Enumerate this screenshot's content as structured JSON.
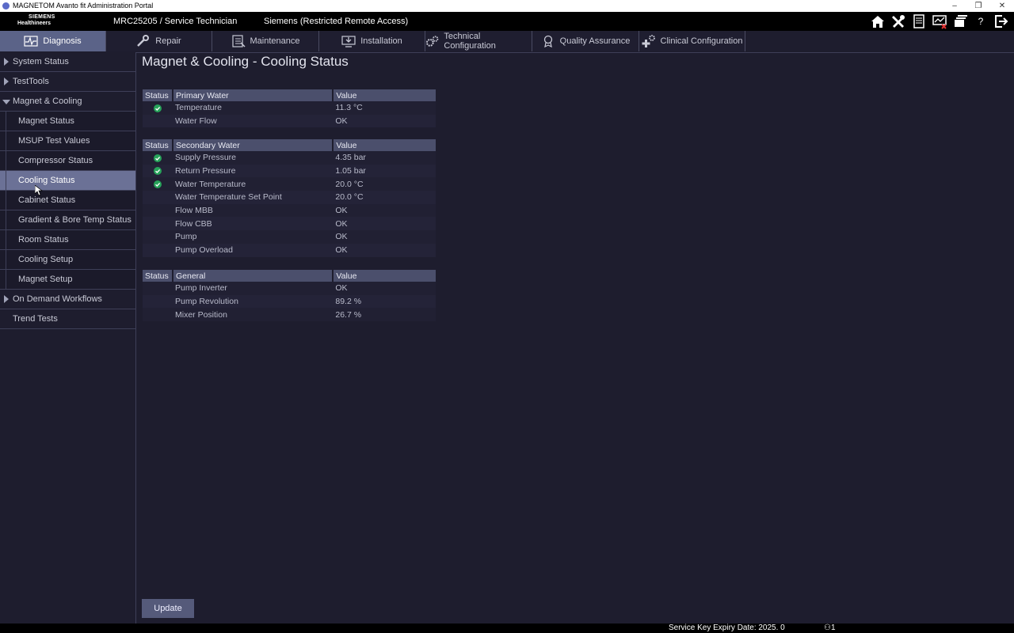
{
  "window": {
    "title": "MAGNETOM Avanto fit Administration Portal",
    "controls": [
      "–",
      "❐",
      "✕"
    ]
  },
  "header": {
    "logo_line1": "SIEMENS",
    "logo_line2": "Healthineers",
    "user": "MRC25205 / Service Technician",
    "access": "Siemens (Restricted Remote Access)",
    "icons": [
      "home-icon",
      "tools-icon",
      "document-icon",
      "monitor-alert-icon",
      "windows-icon",
      "help-icon",
      "logout-icon"
    ],
    "help_label": "?"
  },
  "tabs": [
    {
      "label": "Diagnosis",
      "icon": "pulse-icon",
      "active": true
    },
    {
      "label": "Repair",
      "icon": "wrench-icon"
    },
    {
      "label": "Maintenance",
      "icon": "checklist-icon"
    },
    {
      "label": "Installation",
      "icon": "monitor-download-icon"
    },
    {
      "label": "Technical Configuration",
      "icon": "gears-icon"
    },
    {
      "label": "Quality Assurance",
      "icon": "ribbon-icon"
    },
    {
      "label": "Clinical Configuration",
      "icon": "plus-gear-icon"
    }
  ],
  "sidebar": {
    "items": [
      {
        "label": "System Status",
        "level": 0,
        "arrow": "right"
      },
      {
        "label": "TestTools",
        "level": 0,
        "arrow": "right"
      },
      {
        "label": "Magnet & Cooling",
        "level": 0,
        "arrow": "down"
      },
      {
        "label": "Magnet Status",
        "level": 1
      },
      {
        "label": "MSUP Test Values",
        "level": 1
      },
      {
        "label": "Compressor Status",
        "level": 1
      },
      {
        "label": "Cooling Status",
        "level": 1,
        "selected": true
      },
      {
        "label": "Cabinet Status",
        "level": 1
      },
      {
        "label": "Gradient & Bore Temp Status",
        "level": 1
      },
      {
        "label": "Room Status",
        "level": 1
      },
      {
        "label": "Cooling Setup",
        "level": 1
      },
      {
        "label": "Magnet Setup",
        "level": 1
      },
      {
        "label": "On Demand Workflows",
        "level": 0,
        "arrow": "right"
      },
      {
        "label": "Trend Tests",
        "level": 0
      }
    ]
  },
  "main": {
    "title": "Magnet & Cooling - Cooling Status",
    "tables": [
      {
        "headers": [
          "Status",
          "Primary Water",
          "Value"
        ],
        "rows": [
          {
            "ok": true,
            "name": "Temperature",
            "value": "11.3 °C"
          },
          {
            "ok": false,
            "name": "Water Flow",
            "value": "OK"
          }
        ]
      },
      {
        "headers": [
          "Status",
          "Secondary Water",
          "Value"
        ],
        "rows": [
          {
            "ok": true,
            "name": "Supply Pressure",
            "value": "4.35 bar"
          },
          {
            "ok": true,
            "name": "Return Pressure",
            "value": "1.05 bar"
          },
          {
            "ok": true,
            "name": "Water Temperature",
            "value": "20.0 °C"
          },
          {
            "ok": false,
            "name": "Water Temperature Set Point",
            "value": "20.0 °C"
          },
          {
            "ok": false,
            "name": "Flow MBB",
            "value": "OK"
          },
          {
            "ok": false,
            "name": "Flow CBB",
            "value": "OK"
          },
          {
            "ok": false,
            "name": "Pump",
            "value": "OK"
          },
          {
            "ok": false,
            "name": "Pump Overload",
            "value": "OK"
          }
        ]
      },
      {
        "headers": [
          "Status",
          "General",
          "Value"
        ],
        "rows": [
          {
            "ok": false,
            "name": "Pump Inverter",
            "value": "OK"
          },
          {
            "ok": false,
            "name": "Pump Revolution",
            "value": "89.2 %"
          },
          {
            "ok": false,
            "name": "Mixer Position",
            "value": "26.7 %"
          }
        ]
      }
    ],
    "update_label": "Update"
  },
  "statusbar": {
    "expiry": "Service Key Expiry Date: 2025. 0",
    "users": "1"
  },
  "colors": {
    "ok": "#27a35a",
    "accent_tab": "#5b6388",
    "selected_item": "#6b7196"
  }
}
